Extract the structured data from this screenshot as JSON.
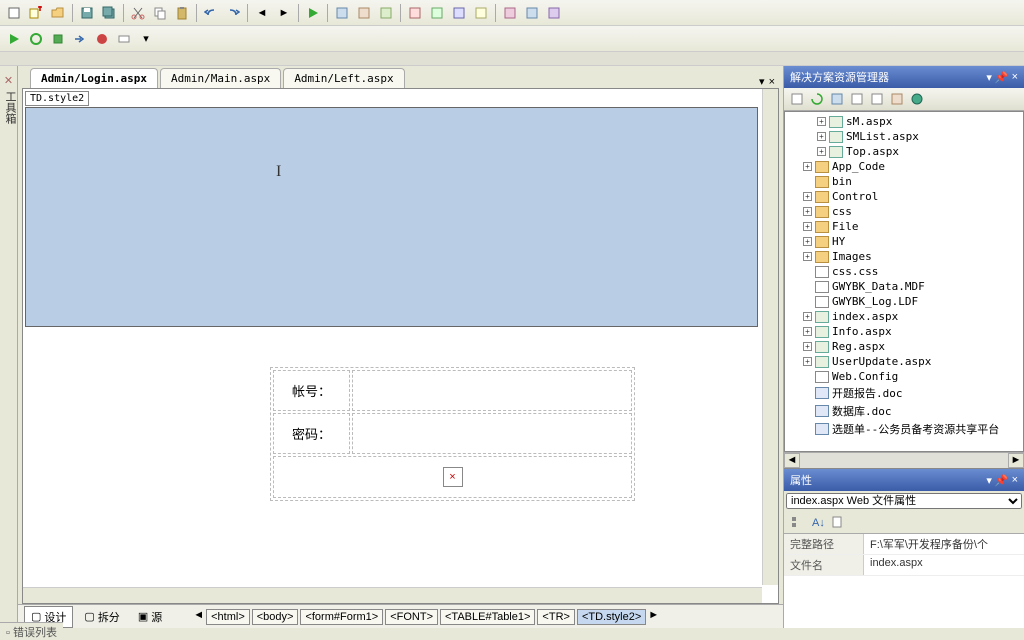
{
  "toolbars": {
    "row1": [
      "new",
      "add",
      "open",
      "sep",
      "save",
      "saveall",
      "sep",
      "cut",
      "copy",
      "paste",
      "sep",
      "undo",
      "redo",
      "sep",
      "nav-back",
      "nav-fwd",
      "sep",
      "play",
      "sep",
      "find",
      "sep",
      "comment",
      "uncomment",
      "sep",
      "window",
      "sep",
      "help",
      "a",
      "b",
      "c",
      "d"
    ],
    "row2": [
      "build",
      "rebuild",
      "debug",
      "step",
      "breakpoint",
      "watch",
      "config"
    ]
  },
  "tabs": {
    "active": "Admin/Login.aspx",
    "items": [
      "Admin/Login.aspx",
      "Admin/Main.aspx",
      "Admin/Left.aspx"
    ]
  },
  "side_tab": "工具箱",
  "designer": {
    "tag_label": "TD.style2",
    "form": {
      "row1_label": "帐号：",
      "row2_label": "密码："
    }
  },
  "view_modes": {
    "design": "设计",
    "split": "拆分",
    "source": "源"
  },
  "breadcrumb": [
    "<html>",
    "<body>",
    "<form#Form1>",
    "<FONT>",
    "<TABLE#Table1>",
    "<TR>",
    "<TD.style2>"
  ],
  "solution_explorer": {
    "title": "解决方案资源管理器",
    "items": [
      {
        "indent": 2,
        "exp": "+",
        "icon": "aspx",
        "label": "sM.aspx"
      },
      {
        "indent": 2,
        "exp": "+",
        "icon": "aspx",
        "label": "SMList.aspx"
      },
      {
        "indent": 2,
        "exp": "+",
        "icon": "aspx",
        "label": "Top.aspx"
      },
      {
        "indent": 1,
        "exp": "+",
        "icon": "folder",
        "label": "App_Code"
      },
      {
        "indent": 1,
        "exp": "",
        "icon": "folder",
        "label": "bin"
      },
      {
        "indent": 1,
        "exp": "+",
        "icon": "folder",
        "label": "Control"
      },
      {
        "indent": 1,
        "exp": "+",
        "icon": "folder",
        "label": "css"
      },
      {
        "indent": 1,
        "exp": "+",
        "icon": "folder",
        "label": "File"
      },
      {
        "indent": 1,
        "exp": "+",
        "icon": "folder",
        "label": "HY"
      },
      {
        "indent": 1,
        "exp": "+",
        "icon": "folder",
        "label": "Images"
      },
      {
        "indent": 1,
        "exp": "",
        "icon": "css",
        "label": "css.css"
      },
      {
        "indent": 1,
        "exp": "",
        "icon": "file",
        "label": "GWYBK_Data.MDF"
      },
      {
        "indent": 1,
        "exp": "",
        "icon": "file",
        "label": "GWYBK_Log.LDF"
      },
      {
        "indent": 1,
        "exp": "+",
        "icon": "aspx",
        "label": "index.aspx"
      },
      {
        "indent": 1,
        "exp": "+",
        "icon": "aspx",
        "label": "Info.aspx"
      },
      {
        "indent": 1,
        "exp": "+",
        "icon": "aspx",
        "label": "Reg.aspx"
      },
      {
        "indent": 1,
        "exp": "+",
        "icon": "aspx",
        "label": "UserUpdate.aspx"
      },
      {
        "indent": 1,
        "exp": "",
        "icon": "file",
        "label": "Web.Config"
      },
      {
        "indent": 1,
        "exp": "",
        "icon": "doc",
        "label": "开题报告.doc"
      },
      {
        "indent": 1,
        "exp": "",
        "icon": "doc",
        "label": "数据库.doc"
      },
      {
        "indent": 1,
        "exp": "",
        "icon": "doc",
        "label": "选题单--公务员备考资源共享平台"
      }
    ]
  },
  "properties": {
    "title": "属性",
    "selector": "index.aspx Web 文件属性",
    "rows": [
      {
        "label": "完整路径",
        "value": "F:\\军军\\开发程序备份\\个"
      },
      {
        "label": "文件名",
        "value": "index.aspx"
      }
    ]
  },
  "bottom": "错误列表"
}
